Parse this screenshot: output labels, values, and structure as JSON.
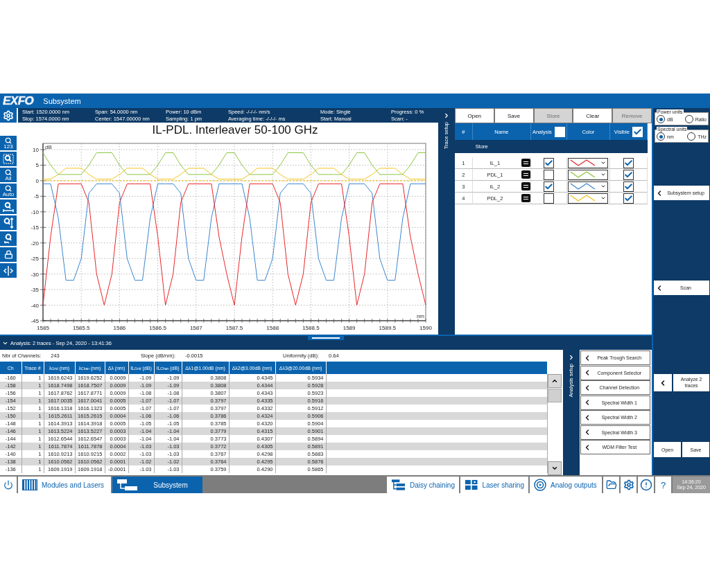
{
  "header": {
    "logo": "EXFO",
    "title": "Subsystem"
  },
  "info": [
    [
      "Start: 1520.0000 nm",
      "Stop: 1574.0000 nm"
    ],
    [
      "Span: 54.0000 nm",
      "Center: 1547.00000 nm"
    ],
    [
      "Power: 10 dBm",
      "Sampling: 1 pm"
    ],
    [
      "Speed: -/-/-/- nm/s",
      "Averaging time: -/-/-/- ms"
    ],
    [
      "Mode: Single",
      "Start: Manual"
    ],
    [
      "Progress: 0 %",
      "Scan: -"
    ]
  ],
  "zoom_tools": [
    {
      "kind": "magnify",
      "label": "123"
    },
    {
      "kind": "box"
    },
    {
      "kind": "magnify",
      "label": "All"
    },
    {
      "kind": "magnify",
      "label": "Auto"
    },
    {
      "kind": "horizontal"
    },
    {
      "kind": "vertical"
    },
    {
      "kind": "out"
    },
    {
      "kind": "lock"
    },
    {
      "kind": "split"
    }
  ],
  "chart": {
    "title": "IL-PDL. Interleaver 50-100 GHz",
    "chart_data": {
      "type": "line",
      "grid": true,
      "ylabel": "dB",
      "xlabel": "nm",
      "xlim": [
        1585,
        1590
      ],
      "ylim": [
        -45,
        12
      ],
      "ref_lines": [
        {
          "axis": "y",
          "value": 0,
          "color": "#e8b800"
        }
      ],
      "xticks": [
        1585,
        1585.5,
        1586,
        1586.5,
        1587,
        1587.5,
        1588,
        1588.5,
        1589,
        1589.5,
        1590
      ],
      "yticks": [
        -45,
        -40,
        -35,
        -30,
        -25,
        -20,
        -15,
        -10,
        -5,
        0,
        5,
        10
      ],
      "x": [
        1585,
        1585.1,
        1585.2,
        1585.3,
        1585.4,
        1585.5,
        1585.6,
        1585.7,
        1585.8,
        1585.9,
        1586,
        1586.1,
        1586.2,
        1586.3,
        1586.4,
        1586.5,
        1586.6,
        1586.7,
        1586.8,
        1586.9,
        1587,
        1587.1,
        1587.2,
        1587.3,
        1587.4,
        1587.5,
        1587.6,
        1587.7,
        1587.8,
        1587.9,
        1588,
        1588.1,
        1588.2,
        1588.3,
        1588.4,
        1588.5,
        1588.6,
        1588.7,
        1588.8,
        1588.9,
        1589,
        1589.1,
        1589.2,
        1589.3,
        1589.4,
        1589.5,
        1589.6,
        1589.7,
        1589.8,
        1589.9,
        1590
      ],
      "series": [
        {
          "color": "#f2c21b",
          "values": [
            0.5,
            0.5,
            2,
            4,
            4,
            4,
            2,
            0.5,
            0.5,
            0.5,
            2,
            4,
            4,
            4,
            2,
            0.5,
            0.5,
            0.5,
            2,
            4,
            4,
            4,
            2,
            0.5,
            0.5,
            0.5,
            0.5,
            2,
            4,
            4,
            4,
            2,
            0.5,
            0.5,
            0.5,
            2,
            4,
            4,
            4,
            2,
            0.5,
            0.5,
            0.5,
            2,
            4,
            4,
            4,
            2,
            0.5,
            0.5,
            0.5
          ]
        },
        {
          "color": "#8cc63e",
          "values": [
            9,
            5,
            2,
            2,
            2,
            2,
            5,
            9,
            9,
            9,
            5,
            2,
            2,
            2,
            2,
            5,
            9,
            9,
            5,
            2,
            2,
            2,
            2,
            5,
            9,
            9,
            5,
            2,
            2,
            2,
            2,
            5,
            9,
            9,
            9,
            5,
            2,
            2,
            2,
            2,
            5,
            9,
            9,
            5,
            2,
            2,
            2,
            2,
            5,
            9,
            9
          ]
        },
        {
          "color": "#3a86cf",
          "values": [
            -1,
            -1,
            -12,
            -32,
            -32,
            -25,
            -4,
            -1,
            -1,
            -1,
            -4,
            -25,
            -32,
            -32,
            -12,
            -1,
            -1,
            -1,
            -4,
            -25,
            -32,
            -32,
            -12,
            -1,
            -1,
            -1,
            -1,
            -12,
            -32,
            -32,
            -25,
            -4,
            -1,
            -1,
            -1,
            -4,
            -25,
            -32,
            -32,
            -12,
            -1,
            -1,
            -1,
            -4,
            -25,
            -32,
            -32,
            -12,
            -1,
            -1,
            -1
          ]
        },
        {
          "color": "#e8262a",
          "values": [
            -40,
            -18,
            -1,
            -1,
            -1,
            -1,
            -7,
            -30,
            -40,
            -30,
            -7,
            -1,
            -1,
            -1,
            -1,
            -18,
            -40,
            -30,
            -7,
            -1,
            -1,
            -1,
            -1,
            -18,
            -30,
            -40,
            -18,
            -1,
            -1,
            -1,
            -1,
            -7,
            -30,
            -40,
            -30,
            -7,
            -1,
            -1,
            -1,
            -1,
            -18,
            -40,
            -30,
            -7,
            -1,
            -1,
            -1,
            -1,
            -18,
            -30,
            -40
          ]
        }
      ]
    }
  },
  "trace_setup": {
    "strip_label": "Trace setup",
    "buttons": [
      {
        "label": "Open",
        "disabled": false
      },
      {
        "label": "Save",
        "disabled": false
      },
      {
        "label": "Store",
        "disabled": true
      },
      {
        "label": "Clear",
        "disabled": false
      },
      {
        "label": "Remove",
        "disabled": true
      }
    ],
    "columns": [
      "#",
      "Name",
      "Analysis",
      "Color",
      "Visible"
    ],
    "analysis_all": false,
    "visible_all": true,
    "group": "Store",
    "traces": [
      {
        "number": "1",
        "name": "IL_1",
        "analysis": true,
        "color": "#e8262a",
        "visible": true
      },
      {
        "number": "2",
        "name": "PDL_1",
        "analysis": false,
        "color": "#8cc63e",
        "visible": true
      },
      {
        "number": "3",
        "name": "IL_2",
        "analysis": true,
        "color": "#3a86cf",
        "visible": true
      },
      {
        "number": "4",
        "name": "PDL_2",
        "analysis": false,
        "color": "#f2c21b",
        "visible": true
      }
    ]
  },
  "units": [
    {
      "label": "Power units",
      "options": [
        {
          "label": "dB",
          "selected": true
        },
        {
          "label": "Ratio",
          "selected": false
        }
      ]
    },
    {
      "label": "Spectral units",
      "options": [
        {
          "label": "nm",
          "selected": true
        },
        {
          "label": "THz",
          "selected": false
        }
      ]
    }
  ],
  "side_buttons": [
    {
      "kind": "nav",
      "label": "Subsystem setup"
    },
    {
      "kind": "nav",
      "label": "Scan"
    },
    {
      "kind": "split",
      "label": "Analyze 2 traces"
    }
  ],
  "file_buttons": [
    "Open",
    "Save"
  ],
  "analysis": {
    "title": "Analysis: 2 traces - Sep 24, 2020 - 13:41:36",
    "stats": [
      {
        "label": "Nbr of Channels:",
        "value": "243"
      },
      {
        "label": "Slope (dB/nm):",
        "value": "-0.0015"
      },
      {
        "label": "Uniformity (dB):",
        "value": "0.64"
      }
    ],
    "columns": [
      "Ch",
      "Trace #",
      "λ$_{Grid}$ (nm)",
      "λ$_{Chan}$ (nm)",
      "Δλ (nm)",
      "IL$_{Grid}$ (dB)",
      "IL$_{Chan}$ (dB)",
      "Δλ1@1.00dB (nm)",
      "Δλ2@3.00dB (nm)",
      "Δλ3@20.00dB (nm)"
    ],
    "rows": [
      [
        "-160",
        "1",
        "1619.6243",
        "1619.6252",
        "0.0009",
        "-1.09",
        "-1.09",
        "0.3808",
        "0.4345",
        "0.5934"
      ],
      [
        "-158",
        "1",
        "1618.7498",
        "1618.7507",
        "0.0009",
        "-1.09",
        "-1.09",
        "0.3808",
        "0.4344",
        "0.5928"
      ],
      [
        "-156",
        "1",
        "1617.8762",
        "1617.8771",
        "0.0009",
        "-1.08",
        "-1.08",
        "0.3807",
        "0.4343",
        "0.5923"
      ],
      [
        "-154",
        "1",
        "1617.0035",
        "1617.0041",
        "0.0005",
        "-1.07",
        "-1.07",
        "0.3797",
        "0.4335",
        "0.5916"
      ],
      [
        "-152",
        "1",
        "1616.1318",
        "1616.1323",
        "0.0005",
        "-1.07",
        "-1.07",
        "0.3797",
        "0.4332",
        "0.5912"
      ],
      [
        "-150",
        "1",
        "1615.2611",
        "1615.2615",
        "0.0004",
        "-1.06",
        "-1.06",
        "0.3786",
        "0.4324",
        "0.5906"
      ],
      [
        "-148",
        "1",
        "1614.3913",
        "1614.3918",
        "0.0005",
        "-1.05",
        "-1.05",
        "0.3785",
        "0.4320",
        "0.5904"
      ],
      [
        "-146",
        "1",
        "1613.5224",
        "1613.5227",
        "0.0003",
        "-1.04",
        "-1.04",
        "0.3779",
        "0.4315",
        "0.5901"
      ],
      [
        "-144",
        "1",
        "1612.6544",
        "1612.6547",
        "0.0003",
        "-1.04",
        "-1.04",
        "0.3773",
        "0.4307",
        "0.5894"
      ],
      [
        "-142",
        "1",
        "1611.7874",
        "1611.7878",
        "0.0004",
        "-1.03",
        "-1.03",
        "0.3772",
        "0.4305",
        "0.5891"
      ],
      [
        "-140",
        "1",
        "1610.9213",
        "1610.9215",
        "0.0002",
        "-1.03",
        "-1.03",
        "0.3767",
        "0.4298",
        "0.5883"
      ],
      [
        "-138",
        "1",
        "1610.0562",
        "1610.0562",
        "0.0001",
        "-1.02",
        "-1.02",
        "0.3764",
        "0.4295",
        "0.5876"
      ],
      [
        "-136",
        "1",
        "1609.1919",
        "1609.1918",
        "-0.0001",
        "-1.03",
        "-1.03",
        "0.3759",
        "0.4290",
        "0.5865"
      ]
    ],
    "strip_label": "Analysis setup",
    "setup_buttons": [
      "Peak Trough Search",
      "Component Selector",
      "Channel Detection",
      "Spectral Width 1",
      "Spectral Width 2",
      "Spectral Width 3",
      "WDM Filter Test"
    ]
  },
  "taskbar": [
    {
      "kind": "power"
    },
    {
      "kind": "modules",
      "label": "Modules and Lasers",
      "selected": false
    },
    {
      "kind": "subsystem",
      "label": "Subsystem",
      "selected": true
    },
    {
      "kind": "spacer"
    },
    {
      "kind": "daisy",
      "label": "Daisy chaining",
      "selected": false
    },
    {
      "kind": "laser",
      "label": "Laser sharing",
      "selected": false
    },
    {
      "kind": "analog",
      "label": "Analog outputs",
      "selected": false
    },
    {
      "kind": "folder"
    },
    {
      "kind": "gear"
    },
    {
      "kind": "alert"
    },
    {
      "kind": "help",
      "label": "?"
    }
  ],
  "clock": {
    "time": "14:36:20",
    "date": "Sep 24, 2020"
  }
}
